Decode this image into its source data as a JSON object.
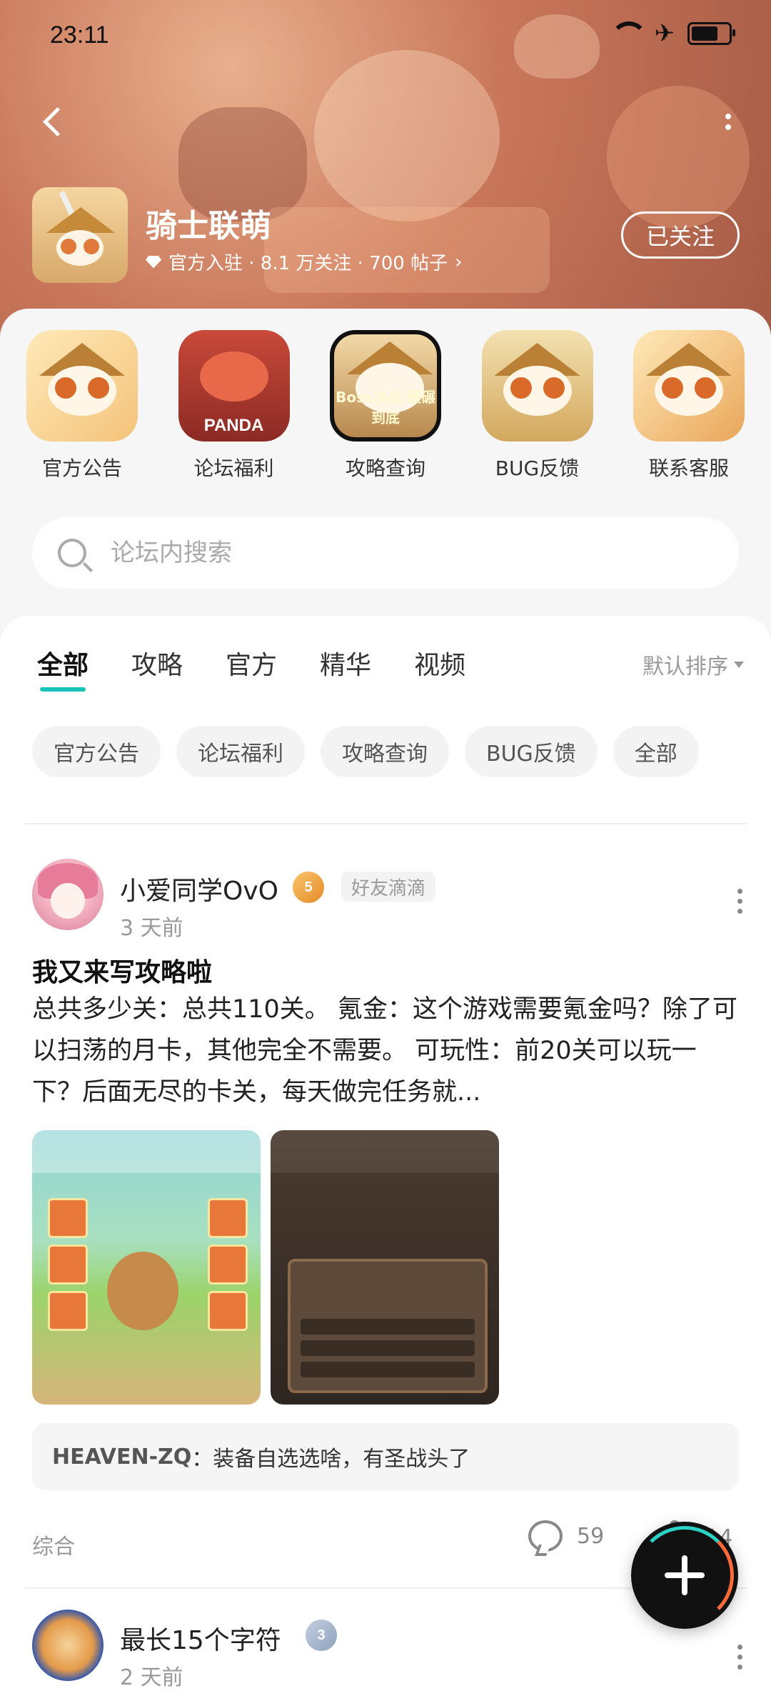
{
  "status_bar": {
    "time": "23:11"
  },
  "forum": {
    "name": "骑士联萌",
    "meta": "官方入驻 · 8.1 万关注 · 700 帖子",
    "follow_label": "已关注"
  },
  "shortcuts": [
    {
      "label": "官方公告",
      "icon": "official-announcement-icon"
    },
    {
      "label": "论坛福利",
      "icon": "forum-benefits-icon",
      "art_text": "PANDA"
    },
    {
      "label": "攻略查询",
      "icon": "guide-search-icon",
      "art_text": "Boss决战 碾碾到底"
    },
    {
      "label": "BUG反馈",
      "icon": "bug-feedback-icon"
    },
    {
      "label": "联系客服",
      "icon": "customer-service-icon"
    }
  ],
  "search": {
    "placeholder": "论坛内搜索"
  },
  "tabs": [
    {
      "label": "全部",
      "active": true
    },
    {
      "label": "攻略"
    },
    {
      "label": "官方"
    },
    {
      "label": "精华"
    },
    {
      "label": "视频"
    }
  ],
  "sort_label": "默认排序",
  "chips": [
    "官方公告",
    "论坛福利",
    "攻略查询",
    "BUG反馈",
    "全部"
  ],
  "posts": [
    {
      "author": "小爱同学OvO",
      "level": "5",
      "tag": "好友滴滴",
      "time": "3 天前",
      "title": "我又来写攻略啦",
      "body": "总共多少关：总共110关。 氪金：这个游戏需要氪金吗？除了可以扫荡的月卡，其他完全不需要。 可玩性：前20关可以玩一下？后面无尽的卡关，每天做完任务就...",
      "comment_preview": {
        "user": "HEAVEN-ZQ",
        "text": "：装备自选选啥，有圣战头了"
      },
      "category": "综合",
      "comments": "59",
      "likes": "14"
    },
    {
      "author": "最长15个字符",
      "level": "3",
      "time": "2 天前"
    }
  ],
  "colors": {
    "accent": "#17c2b6",
    "banner": "#c9775a"
  }
}
